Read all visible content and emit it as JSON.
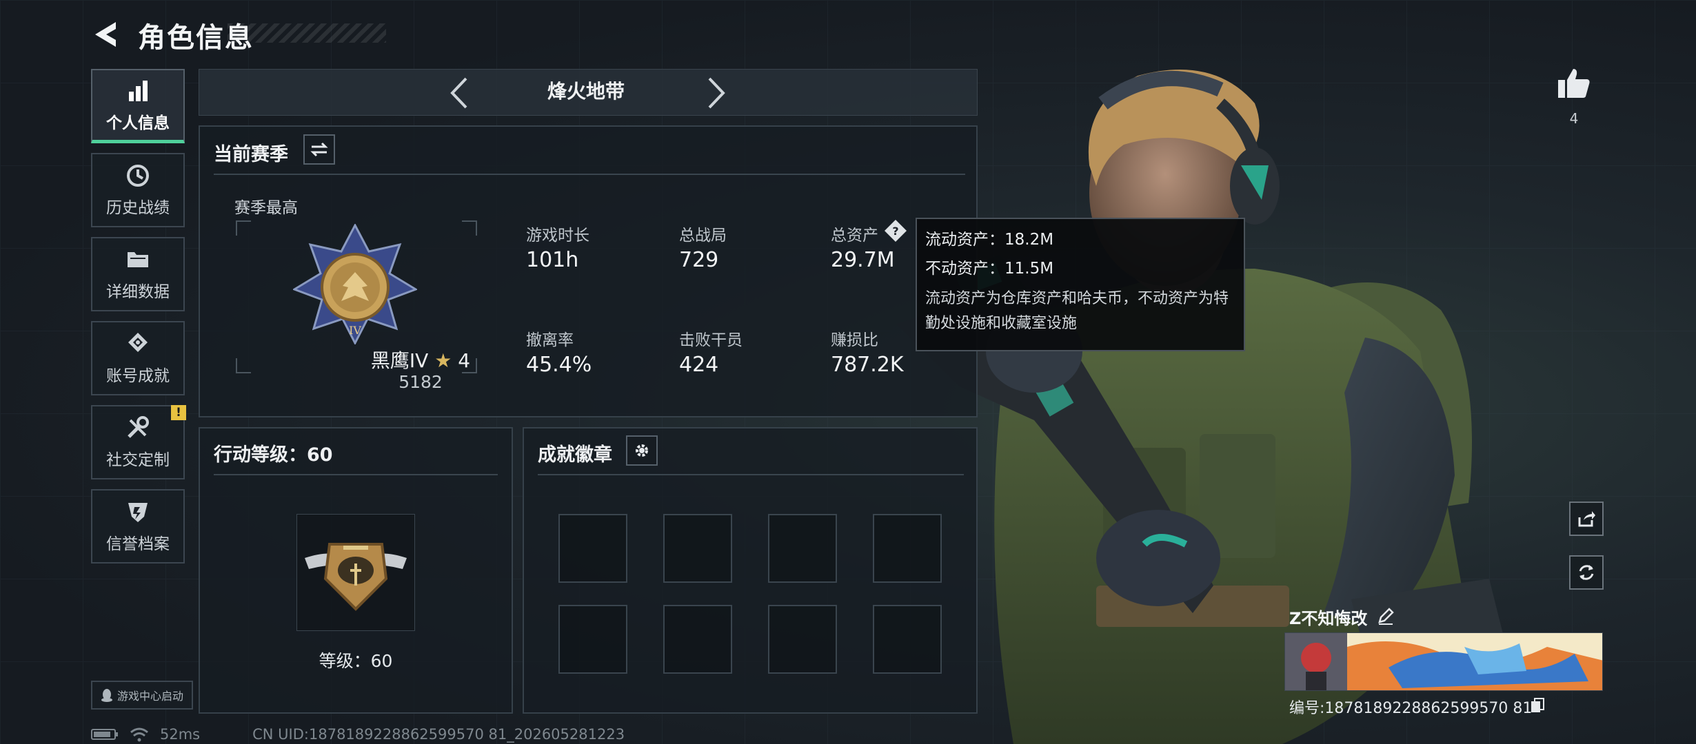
{
  "header": {
    "title": "角色信息",
    "back_icon": "back-arrow-icon"
  },
  "sidebar": {
    "items": [
      {
        "label": "个人信息",
        "icon": "bar-chart-icon",
        "active": true
      },
      {
        "label": "历史战绩",
        "icon": "history-clock-icon",
        "active": false
      },
      {
        "label": "详细数据",
        "icon": "folder-icon",
        "active": false
      },
      {
        "label": "账号成就",
        "icon": "achievement-icon",
        "active": false
      },
      {
        "label": "社交定制",
        "icon": "wrench-icon",
        "active": false,
        "badge": "!"
      },
      {
        "label": "信誉档案",
        "icon": "credit-shield-icon",
        "active": false
      }
    ],
    "game_center": "游戏中心启动"
  },
  "mode": {
    "name": "烽火地带"
  },
  "season": {
    "title": "当前赛季",
    "best_label": "赛季最高",
    "rank_name": "黑鹰IV",
    "rank_stars": "4",
    "rank_score": "5182",
    "stats": [
      {
        "label": "游戏时长",
        "value": "101h"
      },
      {
        "label": "总战局",
        "value": "729"
      },
      {
        "label": "总资产",
        "value": "29.7M"
      },
      {
        "label": "撤离率",
        "value": "45.4%"
      },
      {
        "label": "击败干员",
        "value": "424"
      },
      {
        "label": "赚损比",
        "value": "787.2K"
      }
    ]
  },
  "tooltip": {
    "liquid": "流动资产：18.2M",
    "fixed": "不动资产：11.5M",
    "desc": "流动资产为仓库资产和哈夫币，不动资产为特勤处设施和收藏室设施"
  },
  "action_level": {
    "title": "行动等级：60",
    "level_text": "等级：60"
  },
  "achievements": {
    "title": "成就徽章",
    "slots": 8
  },
  "player": {
    "likes": "4",
    "name": "Z不知悔改",
    "id": "编号:1878189228862599570 81",
    "id_text": "编号:1878189228862599570​81"
  },
  "status": {
    "ping": "52ms",
    "uid": "CN UID:1878189228862599570 81_202605281223"
  },
  "colors": {
    "accent_green": "#4fd09b",
    "warning": "#e8c240",
    "panel_border": "#36414a"
  }
}
